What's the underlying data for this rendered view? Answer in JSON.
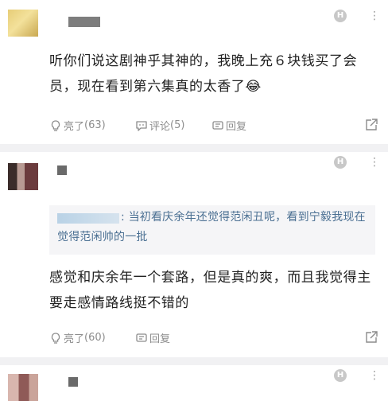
{
  "comments": [
    {
      "text": "听你们说这剧神乎其神的，我晚上充６块钱买了会员，现在看到第六集真的太香了😂",
      "like_label": "亮了",
      "like_count": "(63)",
      "comment_label": "评论",
      "comment_count": "(5)",
      "reply_label": "回复"
    },
    {
      "quote_text": ": 当初看庆余年还觉得范闲丑呢，看到宁毅我现在觉得范闲帅的一批",
      "text": "感觉和庆余年一个套路，但是真的爽，而且我觉得主要走感情路线挺不错的",
      "like_label": "亮了",
      "like_count": "(60)",
      "reply_label": "回复"
    }
  ],
  "icons": {
    "badge_glyph": "H",
    "more_glyph": "⋮",
    "colors": {
      "muted": "#8c8c8c",
      "quote_text": "#4a6f92",
      "divider": "#f1f1f3"
    }
  }
}
